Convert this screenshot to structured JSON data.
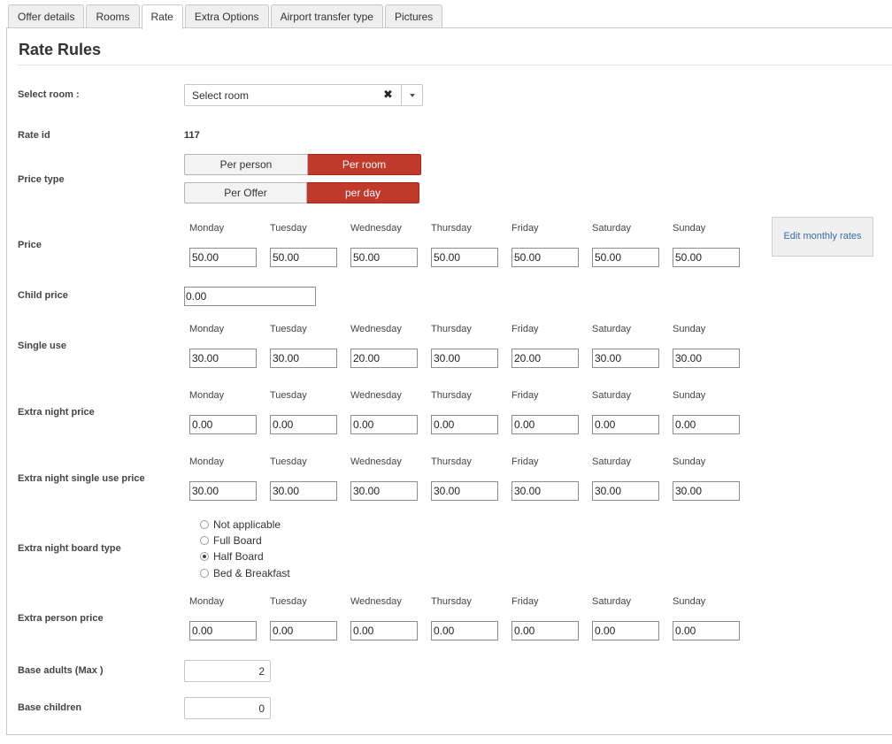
{
  "tabs": [
    {
      "label": "Offer details",
      "active": false
    },
    {
      "label": "Rooms",
      "active": false
    },
    {
      "label": "Rate",
      "active": true
    },
    {
      "label": "Extra Options",
      "active": false
    },
    {
      "label": "Airport transfer type",
      "active": false
    },
    {
      "label": "Pictures",
      "active": false
    }
  ],
  "page_title": "Rate Rules",
  "select_room": {
    "label": "Select room :",
    "value": "Select room"
  },
  "rate_id": {
    "label": "Rate id",
    "value": "117"
  },
  "price_type": {
    "label": "Price type",
    "group1": [
      "Per person",
      "Per room"
    ],
    "group2": [
      "Per Offer",
      "per day"
    ],
    "accent_color": "#c0392b"
  },
  "days": [
    "Monday",
    "Tuesday",
    "Wednesday",
    "Thursday",
    "Friday",
    "Saturday",
    "Sunday"
  ],
  "price": {
    "label": "Price",
    "values": [
      "50.00",
      "50.00",
      "50.00",
      "50.00",
      "50.00",
      "50.00",
      "50.00"
    ]
  },
  "edit_monthly_rates": "Edit monthly rates",
  "child_price": {
    "label": "Child price",
    "value": "0.00"
  },
  "single_use": {
    "label": "Single use",
    "values": [
      "30.00",
      "30.00",
      "20.00",
      "30.00",
      "20.00",
      "30.00",
      "30.00"
    ]
  },
  "extra_night_price": {
    "label": "Extra night price",
    "values": [
      "0.00",
      "0.00",
      "0.00",
      "0.00",
      "0.00",
      "0.00",
      "0.00"
    ]
  },
  "extra_night_single": {
    "label": "Extra night single use price",
    "values": [
      "30.00",
      "30.00",
      "30.00",
      "30.00",
      "30.00",
      "30.00",
      "30.00"
    ]
  },
  "board_type": {
    "label": "Extra night board type",
    "options": [
      "Not applicable",
      "Full Board",
      "Half Board",
      "Bed & Breakfast"
    ],
    "selected": "Half Board"
  },
  "extra_person": {
    "label": "Extra person price",
    "values": [
      "0.00",
      "0.00",
      "0.00",
      "0.00",
      "0.00",
      "0.00",
      "0.00"
    ]
  },
  "base_adults": {
    "label": "Base adults (Max )",
    "value": "2"
  },
  "base_children": {
    "label": "Base children",
    "value": "0"
  }
}
